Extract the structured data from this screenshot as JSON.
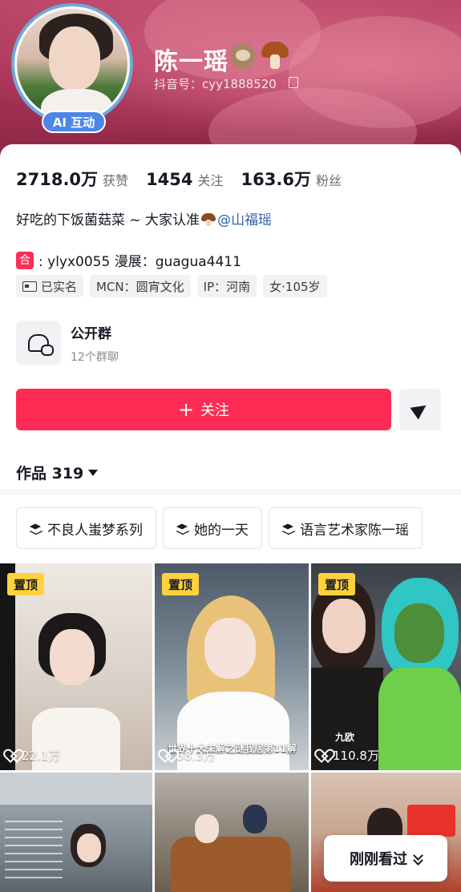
{
  "profile": {
    "name": "陈一瑶",
    "douyin_id": "抖音号：cyy1888520",
    "ai_badge": "AI 互动"
  },
  "stats": [
    {
      "value": "2718.0万",
      "label": "获赞"
    },
    {
      "value": "1454",
      "label": "关注"
    },
    {
      "value": "163.6万",
      "label": "粉丝"
    }
  ],
  "bio": {
    "text": "好吃的下饭菌菇菜 ~ 大家认准",
    "mention": "@山福瑶"
  },
  "collab": {
    "tag": "合",
    "text": ": ylyx0055 漫展：guagua4411"
  },
  "tags": [
    "已实名",
    "MCN：圆宵文化",
    "IP：河南",
    "女·105岁"
  ],
  "group": {
    "title": "公开群",
    "subtitle": "12个群聊"
  },
  "follow_button": "关注",
  "works": {
    "label": "作品 319"
  },
  "collections": [
    "不良人蚩梦系列",
    "她的一天",
    "语言艺术家陈一瑶"
  ],
  "videos": [
    {
      "pinned": "置顶",
      "likes": "22.1万"
    },
    {
      "pinned": "置顶",
      "likes": "58.3万",
      "caption": "世界十大未解之谜我居第11解"
    },
    {
      "pinned": "置顶",
      "likes": "110.8万",
      "caption": "九欧"
    }
  ],
  "recent_button": "刚刚看过",
  "colors": {
    "accent": "#fe2c55",
    "pin": "#ffd23c",
    "badge": "#4e86e8",
    "mention": "#2f5fa6"
  }
}
